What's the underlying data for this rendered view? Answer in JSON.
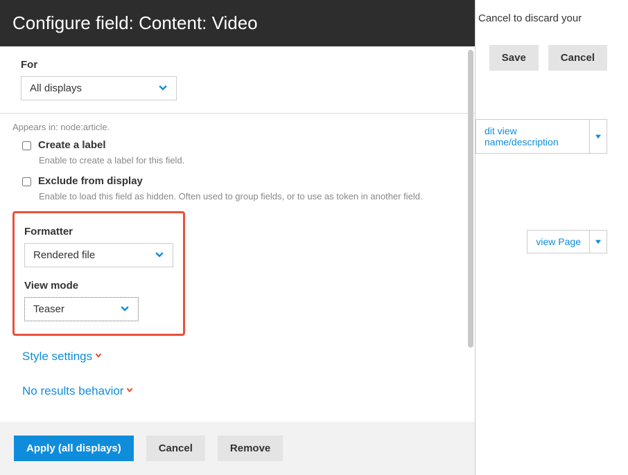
{
  "modal": {
    "title": "Configure field: Content: Video",
    "for_label": "For",
    "for_value": "All displays",
    "appears_in": "Appears in: node:article.",
    "create_label_checkbox": "Create a label",
    "create_label_desc": "Enable to create a label for this field.",
    "exclude_checkbox": "Exclude from display",
    "exclude_desc": "Enable to load this field as hidden. Often used to group fields, or to use as token in another field.",
    "formatter_label": "Formatter",
    "formatter_value": "Rendered file",
    "view_mode_label": "View mode",
    "view_mode_value": "Teaser",
    "style_settings": "Style settings",
    "no_results": "No results behavior",
    "apply_btn": "Apply (all displays)",
    "cancel_btn": "Cancel",
    "remove_btn": "Remove"
  },
  "background": {
    "partial_text": "Cancel to discard your",
    "save_btn": "Save",
    "cancel_btn": "Cancel",
    "edit_view": "dit view name/description",
    "view_page": "view Page"
  }
}
